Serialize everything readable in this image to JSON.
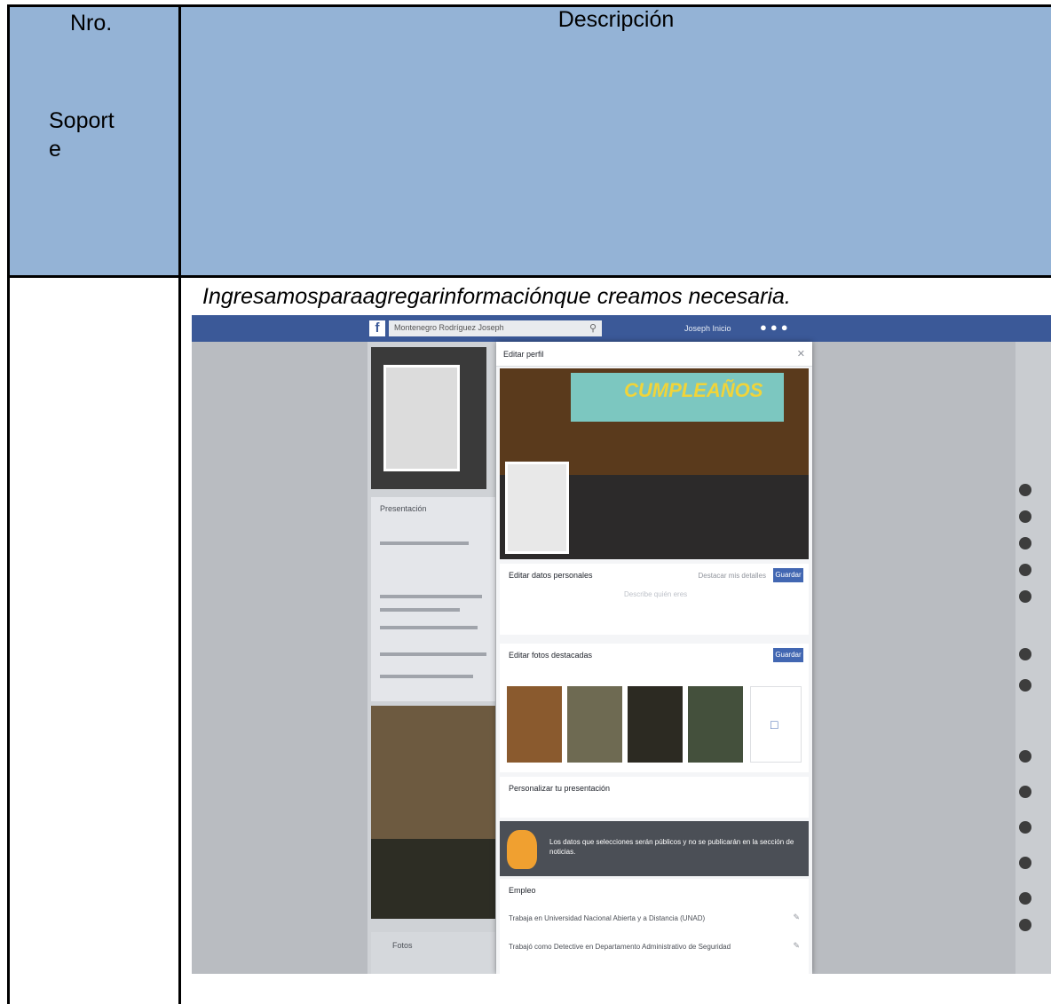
{
  "table": {
    "col_nro": "Nro.",
    "col_soporte_line1": "Soport",
    "col_soporte_line2": "e",
    "col_descripcion": "Descripción",
    "caption": "Ingresamosparaagregarinformaciónque creamos necesaria."
  },
  "screenshot": {
    "fb_logo": "f",
    "search_placeholder": "Montenegro Rodríguez Joseph",
    "top_user": "Joseph   Inicio",
    "left": {
      "intro_title": "Presentación",
      "photos_title": "Fotos"
    },
    "modal": {
      "title": "Editar perfil",
      "cover_text": "CUMPLEAÑOS",
      "sec_details_title": "Editar datos personales",
      "sec_details_link": "Destacar mis detalles",
      "sec_details_button": "Guardar",
      "sec_details_sub": "Describe quién eres",
      "sec_photos_title": "Editar fotos destacadas",
      "sec_photos_button": "Guardar",
      "sec_custom_title": "Personalizar tu presentación",
      "notice": "Los datos que selecciones serán públicos y no se publicarán en la sección de noticias.",
      "sec_jobs_title": "Empleo",
      "job1": "Trabaja en Universidad Nacional Abierta y a Distancia (UNAD)",
      "job2": "Trabajó como Detective en Departamento Administrativo de Seguridad"
    }
  }
}
